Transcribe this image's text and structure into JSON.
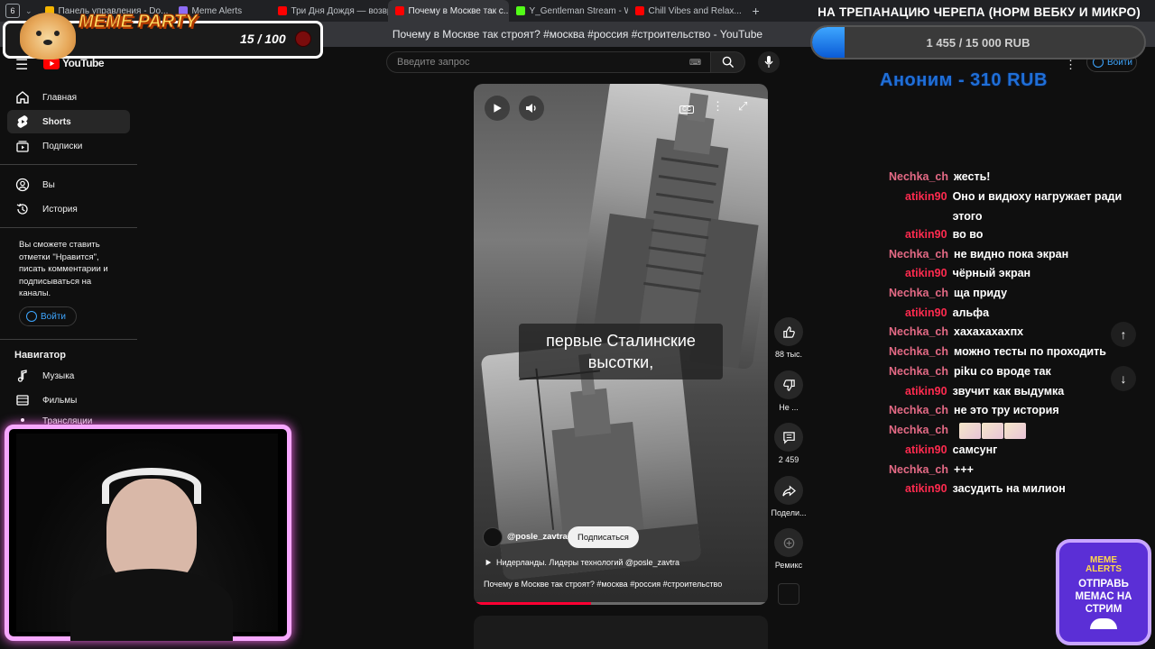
{
  "browser": {
    "tab_count": "6",
    "tabs": [
      {
        "label": "Панель управления - Do...",
        "color": "#f4b400"
      },
      {
        "label": "Meme Alerts",
        "color": "#8e6cf5"
      },
      {
        "label": "Три Дня Дождя — возвра...",
        "color": "#ff0000"
      },
      {
        "label": "Почему в Москве так с...",
        "color": "#ff0000"
      },
      {
        "label": "Y_Gentleman Stream - Wa...",
        "color": "#53fc18"
      },
      {
        "label": "Chill Vibes and Relax...",
        "color": "#ff0000"
      }
    ],
    "page_title": "Почему в Москве так строят? #москва #россия #строительство - YouTube"
  },
  "youtube": {
    "logo_text": "YouTube",
    "search_placeholder": "Введите запрос",
    "signin_label": "Войти",
    "nav": {
      "home": "Главная",
      "shorts": "Shorts",
      "subscriptions": "Подписки",
      "you": "Вы",
      "history": "История",
      "signin_note": "Вы сможете ставить отметки \"Нравится\", писать комментарии и подписываться на каналы.",
      "signin_btn": "Войти",
      "navigator": "Навигатор",
      "music": "Музыка",
      "movies": "Фильмы",
      "broadcasts": "Трансляции"
    },
    "short": {
      "caption": "первые Сталинские высотки,",
      "channel": "@posle_zavtra",
      "subscribe": "Подписаться",
      "music": "Нидерланды. Лидеры технологий @posle_zavtra",
      "title": "Почему в Москве так строят? #москва #россия #строительство",
      "likes": "88 тыс.",
      "dislike": "Не ...",
      "comments": "2 459",
      "share": "Подели...",
      "remix": "Ремикс"
    }
  },
  "overlay": {
    "meme_party": "MEME PARTY",
    "meme_counter": "15 / 100",
    "goal_title": "НА ТРЕПАНАЦИЮ ЧЕРЕПА (НОРМ ВЕБКУ И МИКРО)",
    "goal_progress_text": "1 455 / 15 000 RUB",
    "goal_fraction": 0.097,
    "donation": "Аноним - 310 RUB",
    "badge_brand": "MEME ALERTS",
    "badge_text": "ОТПРАВЬ МЕМАС НА СТРИМ"
  },
  "chat": [
    {
      "user": "Nechka_ch",
      "msg": "жесть!"
    },
    {
      "user": "atikin90",
      "msg": "Оно и видюху нагружает ради этого"
    },
    {
      "user": "atikin90",
      "msg": "во во"
    },
    {
      "user": "Nechka_ch",
      "msg": "не видно пока экран"
    },
    {
      "user": "atikin90",
      "msg": "чёрный экран"
    },
    {
      "user": "Nechka_ch",
      "msg": "ща приду"
    },
    {
      "user": "atikin90",
      "msg": "альфа"
    },
    {
      "user": "Nechka_ch",
      "msg": "хахахахахпх"
    },
    {
      "user": "Nechka_ch",
      "msg": "можно тесты по проходить"
    },
    {
      "user": "Nechka_ch",
      "msg": "piku со вроде так"
    },
    {
      "user": "atikin90",
      "msg": "звучит как выдумка"
    },
    {
      "user": "Nechka_ch",
      "msg": "не это тру история"
    },
    {
      "user": "Nechka_ch",
      "msg": ""
    },
    {
      "user": "atikin90",
      "msg": "самсунг"
    },
    {
      "user": "Nechka_ch",
      "msg": "+++"
    },
    {
      "user": "atikin90",
      "msg": "засудить на милион"
    }
  ]
}
